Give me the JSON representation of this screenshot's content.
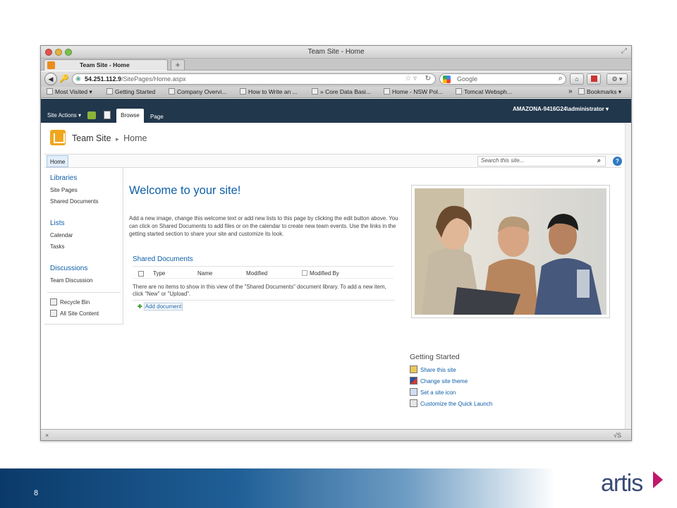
{
  "slide": {
    "number": "8",
    "logo_text": "artis"
  },
  "window": {
    "title": "Team Site - Home"
  },
  "tab": {
    "label": "Team Site - Home",
    "new_tab": "+"
  },
  "address_bar": {
    "host": "54.251.112.9",
    "path": "/SitePages/Home.aspx"
  },
  "search_bar": {
    "placeholder": "Google"
  },
  "bookmarks": {
    "items": [
      "Most Visited ▾",
      "Getting Started",
      "Company Overvi...",
      "How to Write an ...",
      "» Core Data Basi...",
      "Home - NSW Pol...",
      "Tomcat Websph..."
    ],
    "overflow": "»",
    "bookmarks_menu": "Bookmarks ▾"
  },
  "ribbon": {
    "site_actions": "Site Actions ▾",
    "tab_browse": "Browse",
    "tab_page": "Page",
    "user": "AMAZONA-9416G24\\administrator ▾"
  },
  "site": {
    "title": "Team Site",
    "separator": "▸",
    "page": "Home",
    "topnav_home": "Home",
    "search_placeholder": "Search this site...",
    "help": "?"
  },
  "quicklaunch": {
    "libraries_heading": "Libraries",
    "libraries": [
      "Site Pages",
      "Shared Documents"
    ],
    "lists_heading": "Lists",
    "lists": [
      "Calendar",
      "Tasks"
    ],
    "discussions_heading": "Discussions",
    "discussions": [
      "Team Discussion"
    ],
    "recycle_bin": "Recycle Bin",
    "all_site_content": "All Site Content"
  },
  "main": {
    "welcome_title": "Welcome to your site!",
    "welcome_text": "Add a new image, change this welcome text or add new lists to this page by clicking the edit button above. You can click on Shared Documents to add files or on the calendar to create new team events. Use the links in the getting started section to share your site and customize its look.",
    "shared_documents_title": "Shared Documents",
    "columns": [
      "Type",
      "Name",
      "Modified",
      "Modified By"
    ],
    "empty_message": "There are no items to show in this view of the \"Shared Documents\" document library. To add a new item, click \"New\" or \"Upload\".",
    "add_document": "Add document"
  },
  "getting_started": {
    "title": "Getting Started",
    "items": [
      "Share this site",
      "Change site theme",
      "Set a site icon",
      "Customize the Quick Launch"
    ]
  },
  "colors": {
    "ribbon": "#21374c",
    "link_blue": "#0e5fa8",
    "sharepoint_orange": "#f0a61f",
    "artis_navy": "#3a4a76",
    "artis_magenta": "#c0186b"
  }
}
